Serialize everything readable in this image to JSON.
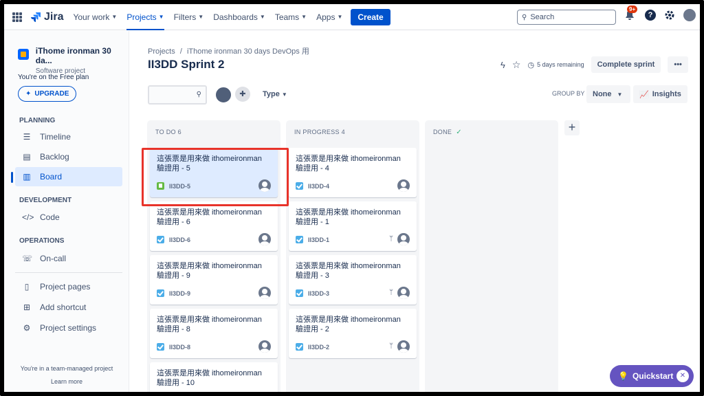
{
  "nav": {
    "brand": "Jira",
    "items": [
      {
        "label": "Your work"
      },
      {
        "label": "Projects"
      },
      {
        "label": "Filters"
      },
      {
        "label": "Dashboards"
      },
      {
        "label": "Teams"
      },
      {
        "label": "Apps"
      }
    ],
    "create": "Create",
    "search_placeholder": "Search",
    "notif_badge": "9+"
  },
  "sidebar": {
    "project_name": "iThome ironman 30 da...",
    "project_type": "Software project",
    "free_plan": "You're on the Free plan",
    "upgrade": "UPGRADE",
    "planning_title": "PLANNING",
    "timeline": "Timeline",
    "backlog": "Backlog",
    "board": "Board",
    "development_title": "DEVELOPMENT",
    "code": "Code",
    "operations_title": "OPERATIONS",
    "oncall": "On-call",
    "project_pages": "Project pages",
    "add_shortcut": "Add shortcut",
    "project_settings": "Project settings",
    "team_note": "You're in a team-managed project",
    "learn_more": "Learn more"
  },
  "header": {
    "crumb_projects": "Projects",
    "crumb_sep": "/",
    "crumb_project": "iThome ironman 30 days DevOps 用",
    "title": "II3DD Sprint 2",
    "remaining": "5 days remaining",
    "complete": "Complete sprint",
    "more": "•••",
    "type_label": "Type",
    "group_by": "GROUP BY",
    "group_value": "None",
    "insights": "Insights"
  },
  "columns": [
    {
      "title": "TO DO 6",
      "check": "",
      "cards": [
        {
          "text": "這張票是用來做 ithomeironman 驗證用 - 5",
          "key": "II3DD-5",
          "type": "story",
          "branch": ""
        },
        {
          "text": "這張票是用來做 ithomeironman 驗證用 - 6",
          "key": "II3DD-6",
          "type": "task",
          "branch": ""
        },
        {
          "text": "這張票是用來做 ithomeironman 驗證用 - 9",
          "key": "II3DD-9",
          "type": "task",
          "branch": ""
        },
        {
          "text": "這張票是用來做 ithomeironman 驗證用 - 8",
          "key": "II3DD-8",
          "type": "task",
          "branch": ""
        },
        {
          "text": "這張票是用來做 ithomeironman 驗證用 - 10",
          "key": "",
          "type": "",
          "branch": ""
        }
      ]
    },
    {
      "title": "IN PROGRESS 4",
      "check": "",
      "cards": [
        {
          "text": "這張票是用來做 ithomeironman 驗證用 - 4",
          "key": "II3DD-4",
          "type": "task",
          "branch": ""
        },
        {
          "text": "這張票是用來做 ithomeironman 驗證用 - 1",
          "key": "II3DD-1",
          "type": "task",
          "branch": "ᛘ"
        },
        {
          "text": "這張票是用來做 ithomeironman 驗證用 - 3",
          "key": "II3DD-3",
          "type": "task",
          "branch": "ᛘ"
        },
        {
          "text": "這張票是用來做 ithomeironman 驗證用 - 2",
          "key": "II3DD-2",
          "type": "task",
          "branch": "ᛘ"
        }
      ]
    },
    {
      "title": "DONE",
      "check": "✓",
      "cards": []
    }
  ],
  "quickstart": "Quickstart",
  "colors": {
    "accent": "#0052cc",
    "highlight": "#e8332a",
    "quickstart": "#6554c0"
  }
}
